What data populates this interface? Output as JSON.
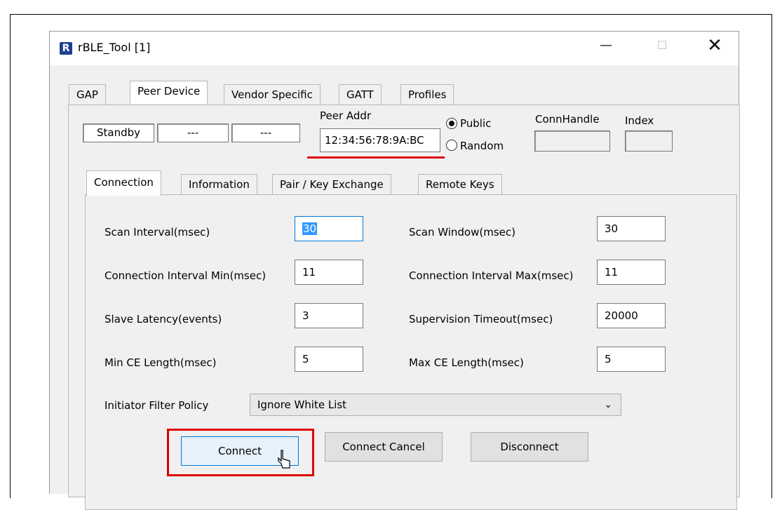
{
  "window": {
    "title": "rBLE_Tool [1]",
    "icon_letter": "R",
    "minimize": "—",
    "maximize": "☐",
    "close": "✕"
  },
  "main_tabs": [
    "GAP",
    "Peer Device",
    "Vendor Specific",
    "GATT",
    "Profiles"
  ],
  "status": {
    "state": "Standby",
    "box2": "---",
    "box3": "---"
  },
  "peer": {
    "addr_label": "Peer Addr",
    "addr_value": "12:34:56:78:9A:BC",
    "public_label": "Public",
    "random_label": "Random",
    "selected": "Public",
    "connhandle_label": "ConnHandle",
    "connhandle_value": "",
    "index_label": "Index",
    "index_value": ""
  },
  "sub_tabs": [
    "Connection",
    "Information",
    "Pair / Key Exchange",
    "Remote Keys"
  ],
  "fields": {
    "scan_interval": {
      "label": "Scan Interval(msec)",
      "value": "30"
    },
    "scan_window": {
      "label": "Scan Window(msec)",
      "value": "30"
    },
    "conn_interval_min": {
      "label": "Connection Interval Min(msec)",
      "value": "11"
    },
    "conn_interval_max": {
      "label": "Connection Interval Max(msec)",
      "value": "11"
    },
    "slave_latency": {
      "label": "Slave Latency(events)",
      "value": "3"
    },
    "supervision_timeout": {
      "label": "Supervision Timeout(msec)",
      "value": "20000"
    },
    "min_ce": {
      "label": "Min CE Length(msec)",
      "value": "5"
    },
    "max_ce": {
      "label": "Max CE Length(msec)",
      "value": "5"
    }
  },
  "filter_policy": {
    "label": "Initiator Filter Policy",
    "selected": "Ignore White List"
  },
  "buttons": {
    "connect": "Connect",
    "connect_cancel": "Connect Cancel",
    "disconnect": "Disconnect"
  },
  "colors": {
    "highlight_red": "#e00000",
    "focus_blue": "#0078d7",
    "selection_blue": "#3399ff",
    "window_bg": "#f0f0f0"
  }
}
